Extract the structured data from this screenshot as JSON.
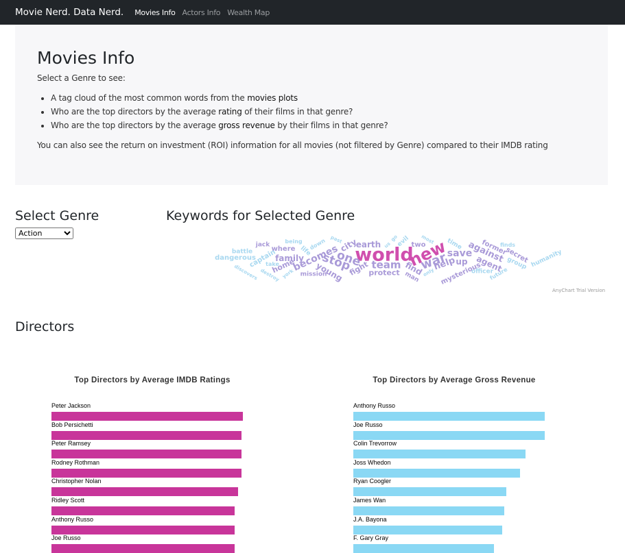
{
  "navbar": {
    "brand": "Movie Nerd. Data Nerd.",
    "links": [
      "Movies Info",
      "Actors Info",
      "Wealth Map"
    ],
    "active": "Movies Info"
  },
  "intro": {
    "title": "Movies Info",
    "lead": "Select a Genre to see:",
    "bullets": [
      {
        "pre": "A tag cloud of the most common words from the ",
        "bold": "movies plots",
        "post": ""
      },
      {
        "pre": "Who are the top directors by the average ",
        "bold": "rating",
        "post": " of their films in that genre?"
      },
      {
        "pre": "Who are the top directors by the average ",
        "bold": "gross revenue",
        "post": " by their films in that genre?"
      }
    ],
    "note": "You can also see the return on investment (ROI) information for all movies (not filtered by Genre) compared to their IMDB rating"
  },
  "genre": {
    "heading": "Select Genre",
    "selected": "Action"
  },
  "keywords": {
    "heading": "Keywords for Selected Genre",
    "trial": "AnyChart Trial Version",
    "words": [
      "world",
      "new",
      "war",
      "save",
      "team",
      "one",
      "stop",
      "becomes",
      "city",
      "earth",
      "family",
      "young",
      "fight",
      "protect",
      "find",
      "help",
      "up",
      "against",
      "agent",
      "mysterious",
      "former",
      "secret",
      "group",
      "finds",
      "humanity",
      "officer",
      "future",
      "time",
      "most",
      "two",
      "evil",
      "go",
      "us",
      "man",
      "only",
      "home",
      "take",
      "where",
      "captain",
      "jack",
      "being",
      "life",
      "down",
      "past",
      "mission",
      "york",
      "destroy",
      "discovers",
      "battle",
      "dangerous"
    ],
    "colors": {
      "high": "#d04fae",
      "mid": "#a99ad8",
      "low": "#a8d8f0"
    }
  },
  "directors": {
    "heading": "Directors"
  },
  "chart_data": [
    {
      "type": "bar",
      "title": "Top Directors by Average IMDB Ratings",
      "color": "#c8359a",
      "value_unit": "relative (% of max)",
      "categories": [
        "Peter Jackson",
        "Bob Persichetti",
        "Peter Ramsey",
        "Rodney Rothman",
        "Christopher Nolan",
        "Ridley Scott",
        "Anthony Russo",
        "Joe Russo"
      ],
      "values": [
        100,
        99.3,
        99.3,
        99.3,
        97.5,
        95.7,
        95.7,
        95.7
      ]
    },
    {
      "type": "bar",
      "title": "Top Directors by Average Gross Revenue",
      "color": "#8ad8f4",
      "value_unit": "relative (% of max)",
      "categories": [
        "Anthony Russo",
        "Joe Russo",
        "Colin Trevorrow",
        "Joss Whedon",
        "Ryan Coogler",
        "James Wan",
        "J.A. Bayona",
        "F. Gary Gray"
      ],
      "values": [
        100,
        100,
        90,
        87.1,
        79.9,
        78.9,
        77.8,
        73.5
      ]
    }
  ]
}
